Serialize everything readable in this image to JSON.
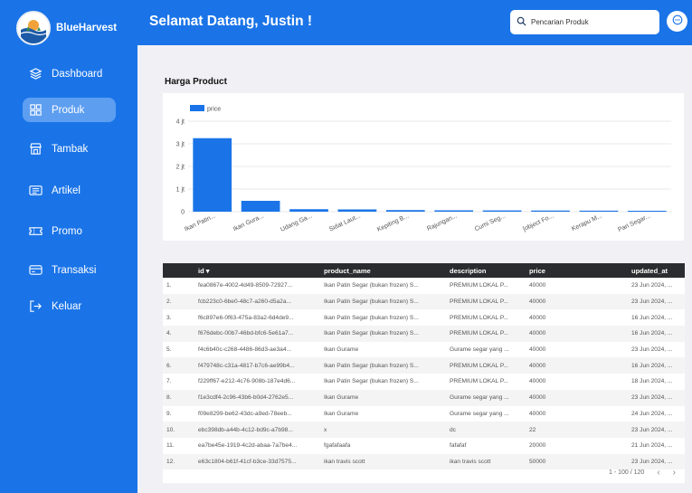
{
  "app": {
    "brand": "BlueHarvest"
  },
  "sidebar": {
    "items": [
      {
        "label": "Dashboard",
        "icon": "layers-icon"
      },
      {
        "label": "Produk",
        "icon": "grid-icon",
        "active": true
      },
      {
        "label": "Tambak",
        "icon": "store-icon"
      },
      {
        "label": "Artikel",
        "icon": "article-icon"
      },
      {
        "label": "Promo",
        "icon": "ticket-icon"
      },
      {
        "label": "Transaksi",
        "icon": "card-icon"
      },
      {
        "label": "Keluar",
        "icon": "logout-icon"
      }
    ]
  },
  "header": {
    "greeting": "Selamat Datang, Justin !",
    "search_placeholder": "Pencarian Produk"
  },
  "main": {
    "section_title": "Harga Product"
  },
  "chart_data": {
    "type": "bar",
    "title": "",
    "legend": [
      "price"
    ],
    "legend_position": "top-left",
    "categories": [
      "Ikan Patin...",
      "Ikan Gura...",
      "Udang Ga...",
      "Sidat Laut...",
      "Kepiting B...",
      "Rajungan...",
      "Cumi Seg...",
      "[object Fo...",
      "Kerapu M...",
      "Pari Segar..."
    ],
    "series": [
      {
        "name": "price",
        "color": "#1a74e8",
        "values": [
          3250000,
          480000,
          110000,
          100000,
          70000,
          60000,
          55000,
          50000,
          45000,
          40000
        ]
      }
    ],
    "y_ticks": [
      "0",
      "1 jt",
      "2 jt",
      "3 jt",
      "4 jt"
    ],
    "ylim": [
      0,
      4000000
    ],
    "grid": true
  },
  "table": {
    "columns": [
      "id",
      "product_name",
      "description",
      "price",
      "updated_at"
    ],
    "rows": [
      {
        "no": "1.",
        "id": "fea0867e-4002-4d49-8509-72927...",
        "product_name": "Ikan Patin Segar (bukan frozen) S...",
        "description": "PREMIUM LOKAL P...",
        "price": "40000",
        "updated_at": "23 Jun 2024, ..."
      },
      {
        "no": "2.",
        "id": "fcb223c0-6be0-48c7-a260-d5a2a...",
        "product_name": "Ikan Patin Segar (bukan frozen) S...",
        "description": "PREMIUM LOKAL P...",
        "price": "40000",
        "updated_at": "23 Jun 2024, ..."
      },
      {
        "no": "3.",
        "id": "f6c897e6-0f63-475a-83a2-6d4de9...",
        "product_name": "Ikan Patin Segar (bukan frozen) S...",
        "description": "PREMIUM LOKAL P...",
        "price": "40000",
        "updated_at": "16 Jun 2024, ..."
      },
      {
        "no": "4.",
        "id": "f676debc-00b7-46bd-bfc6-5e61a7...",
        "product_name": "Ikan Patin Segar (bukan frozen) S...",
        "description": "PREMIUM LOKAL P...",
        "price": "40000",
        "updated_at": "16 Jun 2024, ..."
      },
      {
        "no": "5.",
        "id": "f4c6b40c-c268-4486-86d3-ae3a4...",
        "product_name": "Ikan Gurame",
        "description": "Gurame segar yang ...",
        "price": "40000",
        "updated_at": "23 Jun 2024, ..."
      },
      {
        "no": "6.",
        "id": "f479748c-c31a-4817-b7c6-ae99b4...",
        "product_name": "Ikan Patin Segar (bukan frozen) S...",
        "description": "PREMIUM LOKAL P...",
        "price": "40000",
        "updated_at": "16 Jun 2024, ..."
      },
      {
        "no": "7.",
        "id": "f229ff67-e212-4c76-908b-187e4d6...",
        "product_name": "Ikan Patin Segar (bukan frozen) S...",
        "description": "PREMIUM LOKAL P...",
        "price": "40000",
        "updated_at": "18 Jun 2024, ..."
      },
      {
        "no": "8.",
        "id": "f1e3cdf4-2c96-43b6-b0d4-2762e5...",
        "product_name": "Ikan Gurame",
        "description": "Gurame segar yang ...",
        "price": "40000",
        "updated_at": "23 Jun 2024, ..."
      },
      {
        "no": "9.",
        "id": "f09e8299-be62-43dc-a9ed-78eeb...",
        "product_name": "Ikan Gurame",
        "description": "Gurame segar yang ...",
        "price": "40000",
        "updated_at": "24 Jun 2024, ..."
      },
      {
        "no": "10.",
        "id": "ebc398db-a44b-4c12-bd9c-a7b98...",
        "product_name": "x",
        "description": "dc",
        "price": "22",
        "updated_at": "23 Jun 2024, ..."
      },
      {
        "no": "11.",
        "id": "ea7be45e-1919-4c2d-abaa-7a7be4...",
        "product_name": "fgafafaafa",
        "description": "fafafaf",
        "price": "20000",
        "updated_at": "21 Jun 2024, ..."
      },
      {
        "no": "12.",
        "id": "e63c1804-b61f-41cf-b3ce-33d7575...",
        "product_name": "ikan travis scott",
        "description": "ikan travis scott",
        "price": "50000",
        "updated_at": "23 Jun 2024, ..."
      }
    ],
    "pagination": "1 - 100 / 120"
  }
}
